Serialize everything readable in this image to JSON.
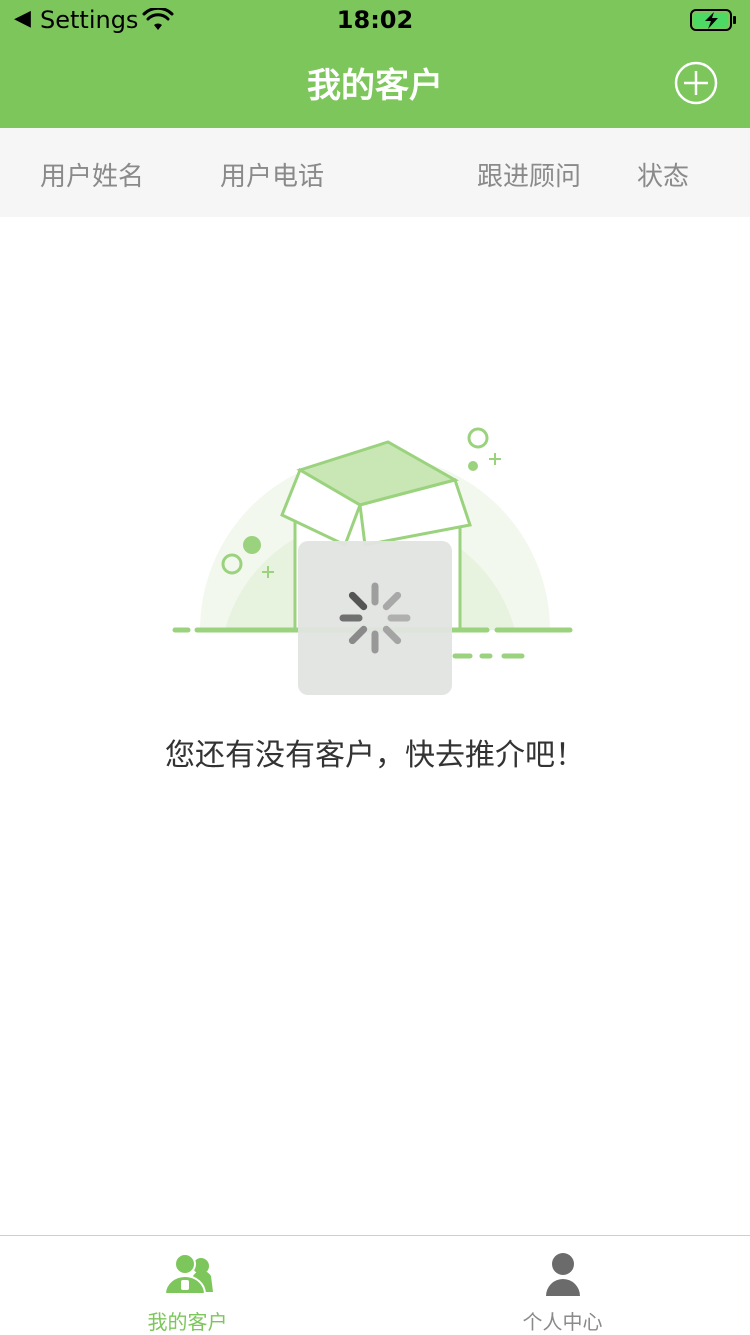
{
  "status_bar": {
    "back_label": "Settings",
    "time": "18:02",
    "icons": [
      "back-arrow-icon",
      "wifi-icon",
      "battery-charging-icon"
    ]
  },
  "header": {
    "title": "我的客户",
    "add_icon": "plus-circle-icon",
    "accent_color": "#7dc65c"
  },
  "table": {
    "columns": [
      "用户姓名",
      "用户电话",
      "跟进顾问",
      "状态"
    ]
  },
  "empty_state": {
    "message": "您还有没有客户，快去推介吧！",
    "illustration_icon": "open-box-icon",
    "loading_icon": "spinner-icon"
  },
  "tab_bar": {
    "tabs": [
      {
        "label": "我的客户",
        "icon": "customers-icon",
        "active": true
      },
      {
        "label": "个人中心",
        "icon": "user-icon",
        "active": false
      }
    ]
  }
}
